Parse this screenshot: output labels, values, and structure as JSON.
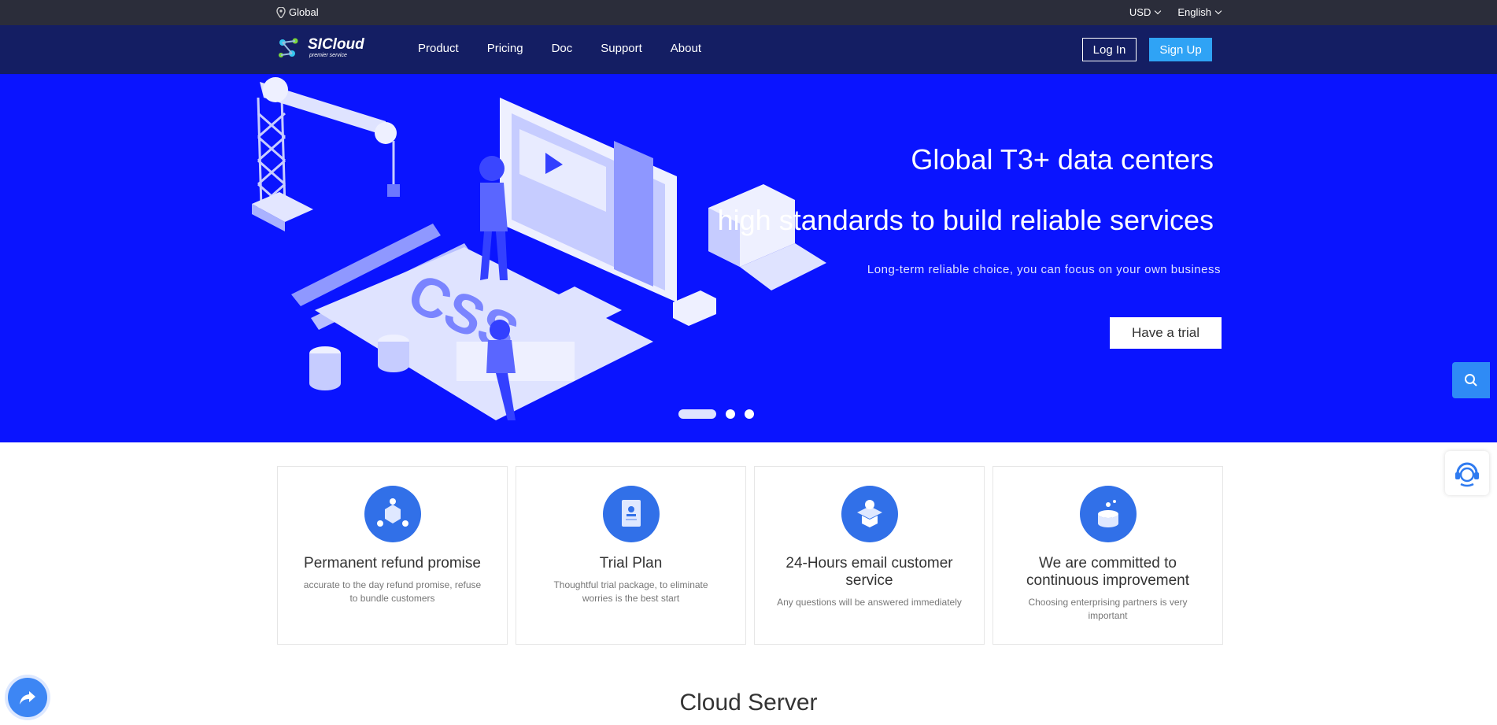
{
  "topbar": {
    "location": "Global",
    "currency": "USD",
    "language": "English"
  },
  "nav": {
    "logo_text": "SICloud",
    "logo_sub": "premier service",
    "menu": [
      "Product",
      "Pricing",
      "Doc",
      "Support",
      "About"
    ],
    "login": "Log In",
    "signup": "Sign Up"
  },
  "hero": {
    "title1": "Global T3+ data centers",
    "title2": "high standards to build reliable services",
    "subtitle": "Long-term reliable choice, you can focus on your own business",
    "cta": "Have a trial",
    "illustration_text": "CSS",
    "slides_total": 3,
    "slide_active": 1
  },
  "features": [
    {
      "title": "Permanent refund promise",
      "desc": "accurate to the day refund promise, refuse to bundle customers",
      "icon": "cube-network-icon"
    },
    {
      "title": "Trial Plan",
      "desc": "Thoughtful trial package, to eliminate worries is the best start",
      "icon": "id-card-icon"
    },
    {
      "title": "24-Hours email customer service",
      "desc": "Any questions will be answered immediately",
      "icon": "graduation-cap-icon"
    },
    {
      "title": "We are committed to continuous improvement",
      "desc": "Choosing enterprising partners is very important",
      "icon": "database-icon"
    }
  ],
  "section_title": "Cloud Server",
  "colors": {
    "topbar": "#2b2d3a",
    "nav": "#141e63",
    "hero": "#0a14ff",
    "signup": "#2fa3f5",
    "accent": "#3170e8"
  }
}
